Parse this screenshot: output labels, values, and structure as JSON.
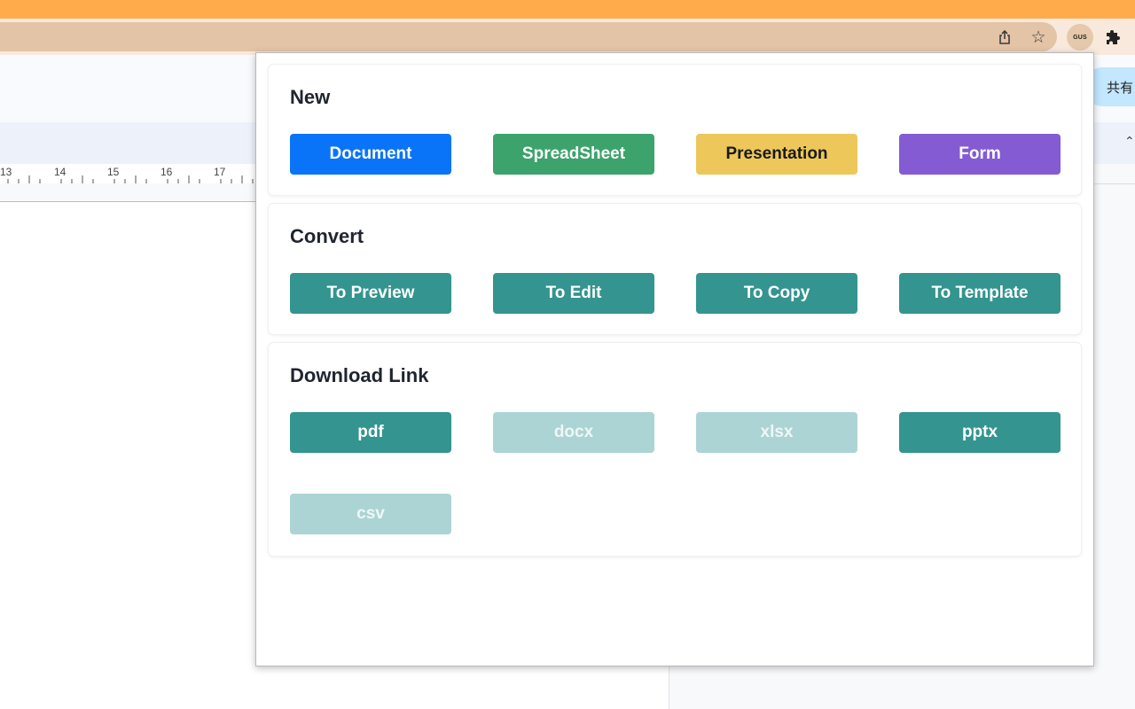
{
  "browser": {
    "extension_badge": "GUS",
    "icons": [
      "share-icon",
      "star-icon",
      "puzzle-icon"
    ]
  },
  "doc": {
    "share_label": "共有",
    "ruler_numbers": [
      "13",
      "14",
      "15",
      "16",
      "17"
    ]
  },
  "popup": {
    "new": {
      "title": "New",
      "buttons": [
        {
          "label": "Document",
          "color": "#0a74f8"
        },
        {
          "label": "SpreadSheet",
          "color": "#3ca36c"
        },
        {
          "label": "Presentation",
          "color": "#edc75a"
        },
        {
          "label": "Form",
          "color": "#845bd3"
        }
      ]
    },
    "convert": {
      "title": "Convert",
      "buttons": [
        {
          "label": "To Preview"
        },
        {
          "label": "To Edit"
        },
        {
          "label": "To Copy"
        },
        {
          "label": "To Template"
        }
      ]
    },
    "download": {
      "title": "Download Link",
      "buttons": [
        {
          "label": "pdf",
          "enabled": true
        },
        {
          "label": "docx",
          "enabled": false
        },
        {
          "label": "xlsx",
          "enabled": false
        },
        {
          "label": "pptx",
          "enabled": true
        },
        {
          "label": "csv",
          "enabled": false
        }
      ]
    }
  }
}
